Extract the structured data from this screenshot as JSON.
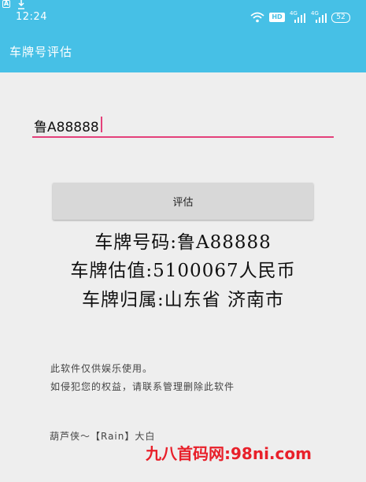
{
  "colors": {
    "app_bar": "#46c0e6",
    "accent": "#e4407a",
    "button": "#d8d8d8",
    "background": "#eeeeee",
    "watermark": "#e8202a"
  },
  "status_bar": {
    "notif_letter": "A",
    "time": "12:24",
    "hd_badge": "HD",
    "signal_1": "4G",
    "signal_2": "4G",
    "battery": "52",
    "icons": [
      "notification-a-icon",
      "download-icon",
      "wifi-icon",
      "hd-icon",
      "signal-icon",
      "signal-icon",
      "battery-icon"
    ]
  },
  "app_bar": {
    "title": "车牌号评估"
  },
  "form": {
    "plate_value": "鲁A88888",
    "evaluate_label": "评估"
  },
  "result": {
    "plate_line": "车牌号码:鲁A88888",
    "value_line": "车牌估值:5100067人民币",
    "location_line": "车牌归属:山东省 济南市"
  },
  "disclaimer": {
    "line1": "此软件仅供娱乐使用。",
    "line2": "如侵犯您的权益，请联系管理删除此软件"
  },
  "credit": "葫芦侠～【Rain】大白",
  "watermark": {
    "part1": "九八首码网",
    "part2": ":98ni.com"
  }
}
